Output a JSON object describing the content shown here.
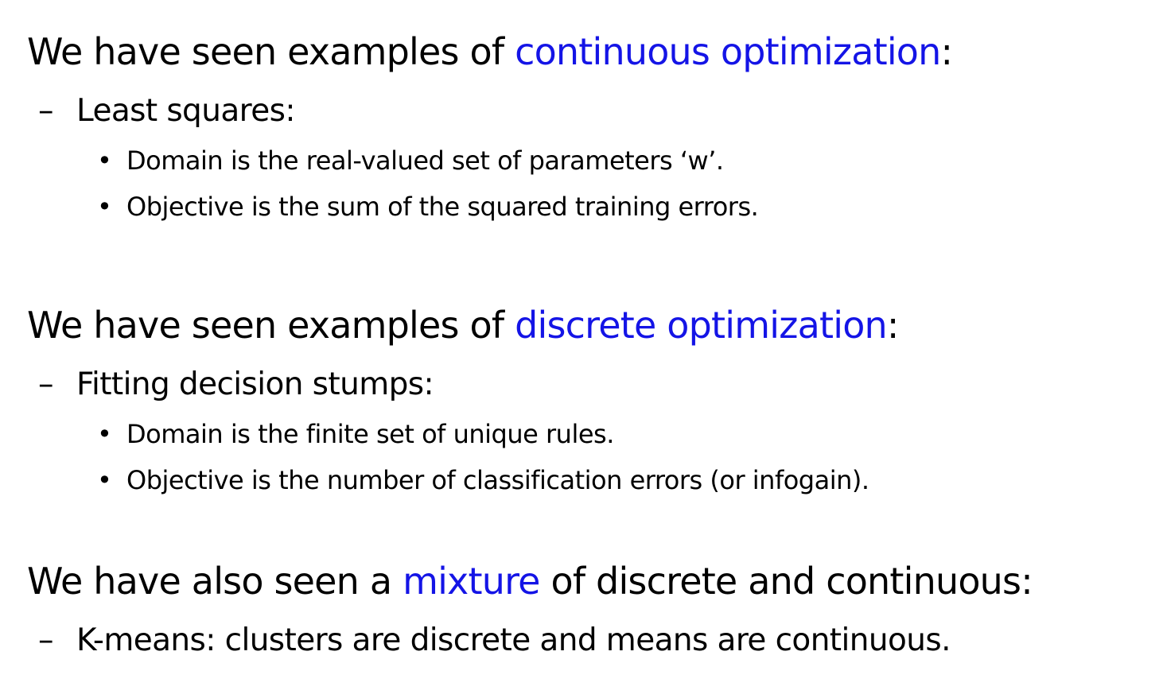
{
  "theme": {
    "text_color": "#000000",
    "accent_color": "#1414E6",
    "background": "#FFFFFF"
  },
  "sections": [
    {
      "heading": {
        "before": "We have seen examples of ",
        "highlight": "continuous optimization",
        "after": ":"
      },
      "dash_marker": "–",
      "sub_item": "Least squares:",
      "bullet_marker": "•",
      "bullets": [
        "Domain is the real-valued set of parameters ‘w’.",
        "Objective is the sum of the squared training errors."
      ]
    },
    {
      "heading": {
        "before": "We have seen examples of ",
        "highlight": "discrete optimization",
        "after": ":"
      },
      "dash_marker": "–",
      "sub_item": "Fitting decision stumps:",
      "bullet_marker": "•",
      "bullets": [
        "Domain is the finite set of unique rules.",
        "Objective is the number of classification errors (or infogain)."
      ]
    },
    {
      "heading": {
        "before": "We have also seen a ",
        "highlight": "mixture",
        "after": " of discrete and continuous:"
      },
      "dash_marker": "–",
      "sub_item": "K-means: clusters are discrete and means are continuous."
    }
  ]
}
